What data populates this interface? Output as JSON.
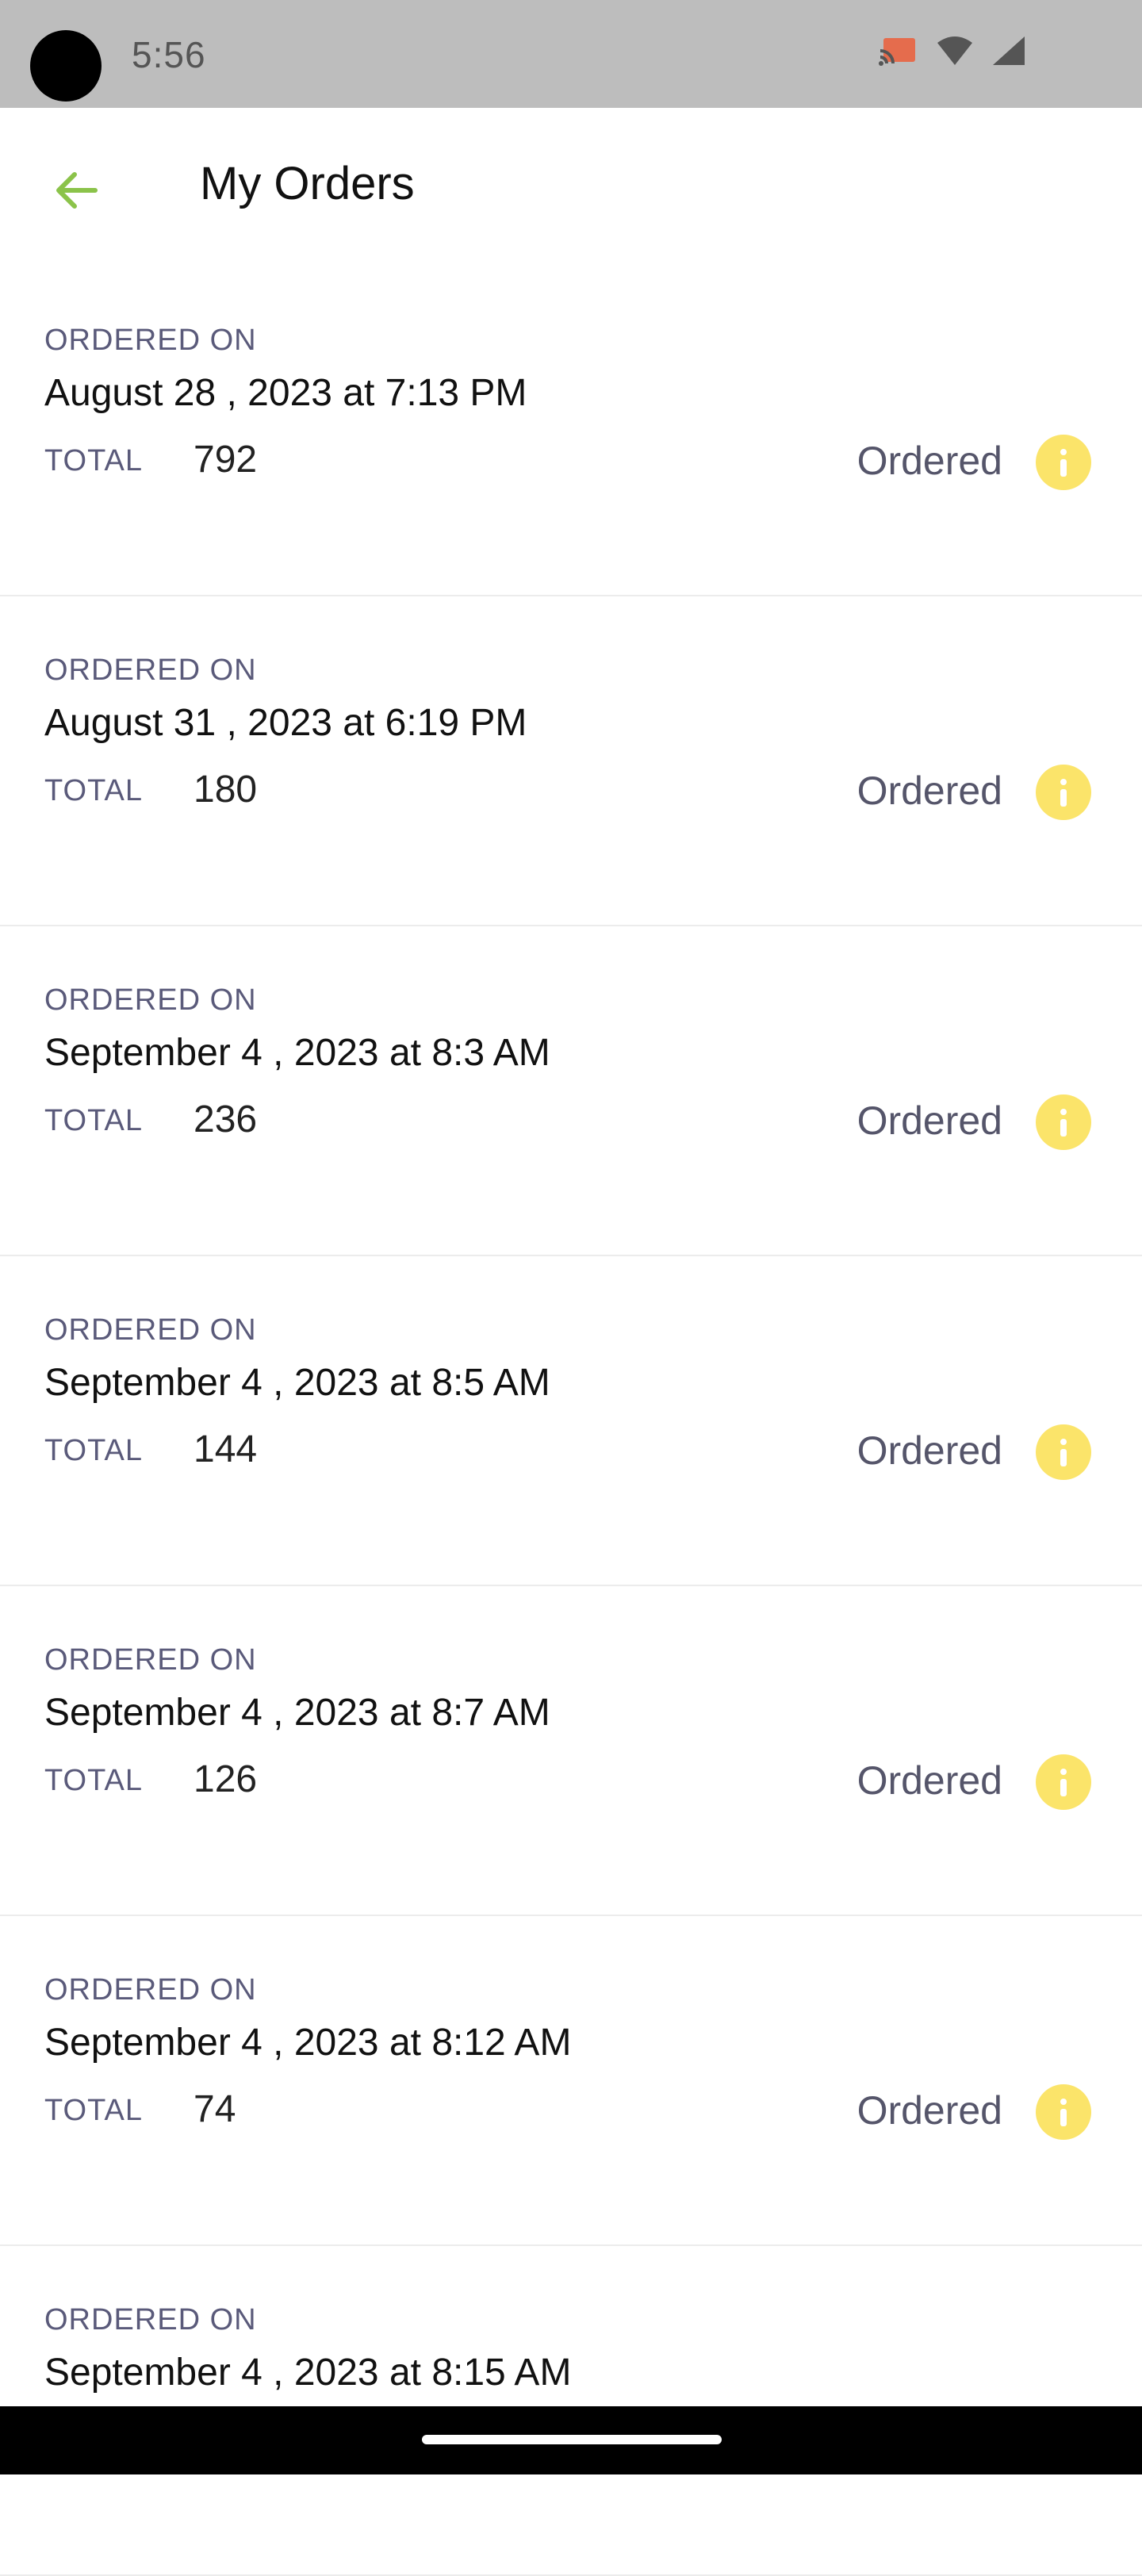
{
  "status_bar": {
    "time": "5:56",
    "icons": [
      "cast-icon",
      "wifi-icon",
      "signal-icon"
    ]
  },
  "app_bar": {
    "title": "My Orders",
    "back_icon": "arrow-left-icon"
  },
  "orders": [
    {
      "ordered_on_label": "ORDERED ON",
      "date": "August 28 , 2023 at 7:13 PM",
      "total_label": "TOTAL",
      "total": "792",
      "status": "Ordered",
      "icon": "info-icon"
    },
    {
      "ordered_on_label": "ORDERED ON",
      "date": "August 31 , 2023 at 6:19 PM",
      "total_label": "TOTAL",
      "total": "180",
      "status": "Ordered",
      "icon": "info-icon"
    },
    {
      "ordered_on_label": "ORDERED ON",
      "date": "September 4 , 2023 at 8:3 AM",
      "total_label": "TOTAL",
      "total": "236",
      "status": "Ordered",
      "icon": "info-icon"
    },
    {
      "ordered_on_label": "ORDERED ON",
      "date": "September 4 , 2023 at 8:5 AM",
      "total_label": "TOTAL",
      "total": "144",
      "status": "Ordered",
      "icon": "info-icon"
    },
    {
      "ordered_on_label": "ORDERED ON",
      "date": "September 4 , 2023 at 8:7 AM",
      "total_label": "TOTAL",
      "total": "126",
      "status": "Ordered",
      "icon": "info-icon"
    },
    {
      "ordered_on_label": "ORDERED ON",
      "date": "September 4 , 2023 at 8:12 AM",
      "total_label": "TOTAL",
      "total": "74",
      "status": "Ordered",
      "icon": "info-icon"
    },
    {
      "ordered_on_label": "ORDERED ON",
      "date": "September 4 , 2023 at 8:15 AM"
    }
  ],
  "colors": {
    "accent": "#8bc34a",
    "info_badge": "#fbe46a",
    "label": "#5a5a7a",
    "status_bar": "#bdbdbd"
  }
}
